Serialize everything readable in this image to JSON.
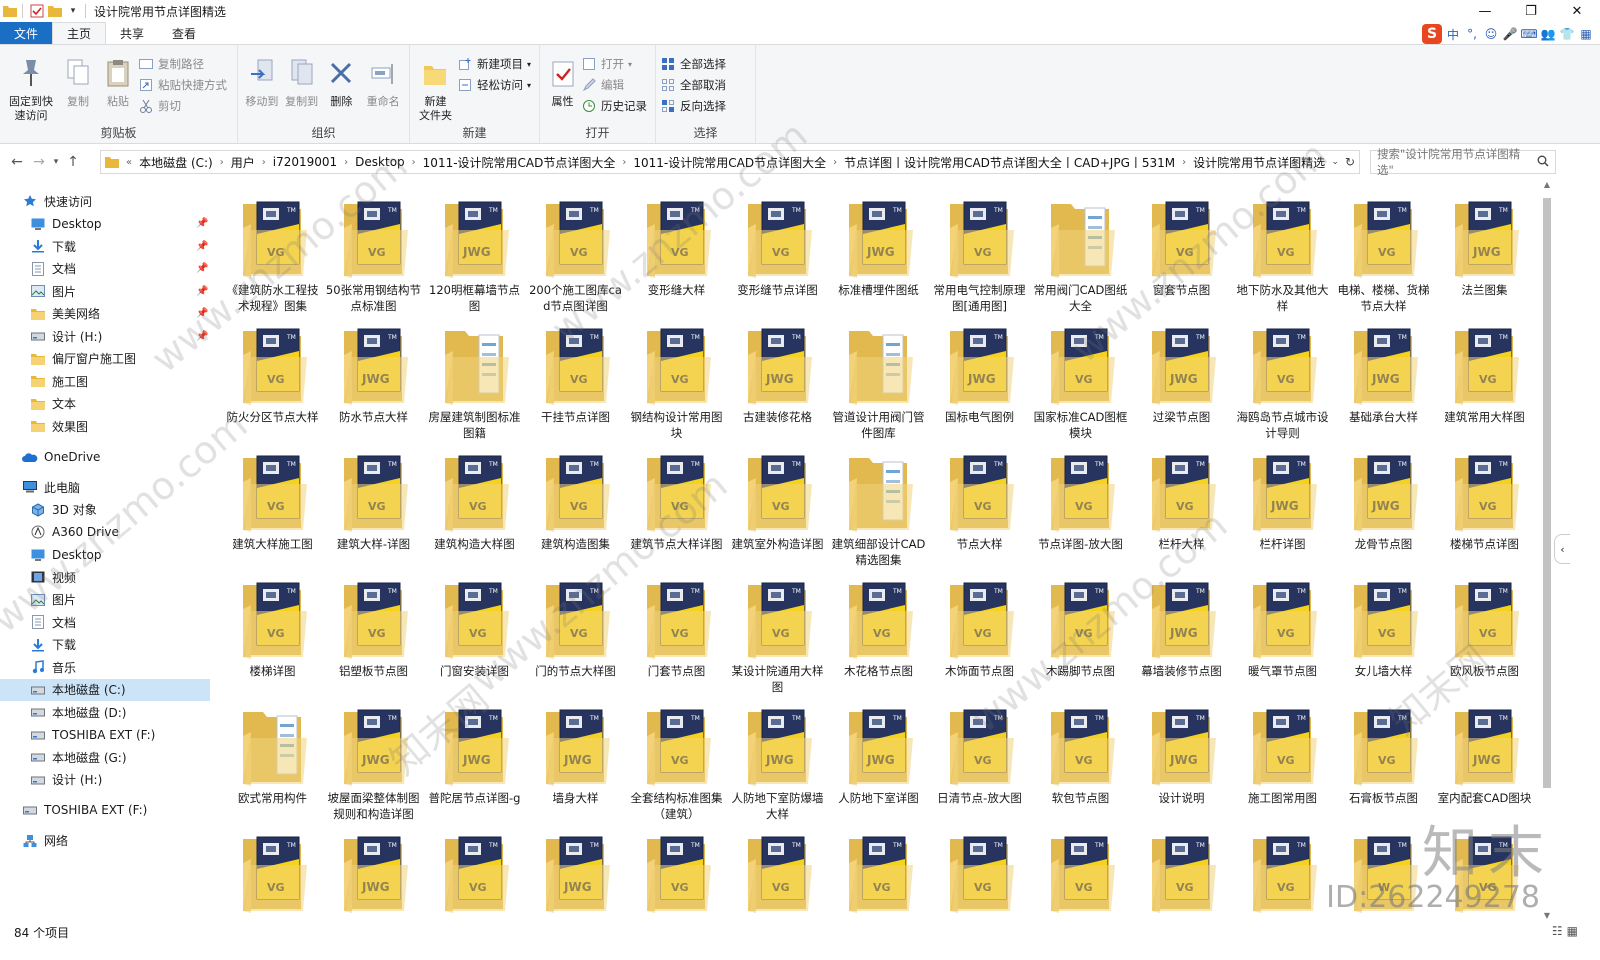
{
  "window": {
    "title": "设计院常用节点详图精选",
    "controls": [
      "—",
      "❐",
      "✕"
    ]
  },
  "ribbon_tabs": [
    {
      "label": "文件",
      "style": "file"
    },
    {
      "label": "主页",
      "style": "active"
    },
    {
      "label": "共享",
      "style": ""
    },
    {
      "label": "查看",
      "style": ""
    }
  ],
  "ime_bar": {
    "logo": "S",
    "items": [
      "中",
      "°,",
      "☺",
      "🎤",
      "⌨",
      "👥",
      "👕",
      "▦"
    ]
  },
  "ribbon": {
    "clipboard": {
      "label": "剪贴板",
      "pin": "固定到快\n速访问",
      "copy": "复制",
      "paste": "粘贴",
      "copy_path": "复制路径",
      "paste_shortcut": "粘贴快捷方式",
      "cut": "剪切"
    },
    "organize": {
      "label": "组织",
      "move_to": "移动到",
      "copy_to": "复制到",
      "delete": "删除",
      "rename": "重命名"
    },
    "new": {
      "label": "新建",
      "new_folder": "新建\n文件夹",
      "new_item": "新建项目",
      "easy_access": "轻松访问"
    },
    "open": {
      "label": "打开",
      "properties": "属性",
      "open": "打开",
      "edit": "编辑",
      "history": "历史记录"
    },
    "select": {
      "label": "选择",
      "select_all": "全部选择",
      "select_none": "全部取消",
      "invert": "反向选择"
    }
  },
  "address": {
    "breadcrumbs": [
      "本地磁盘 (C:)",
      "用户",
      "i72019001",
      "Desktop",
      "1011-设计院常用CAD节点详图大全",
      "1011-设计院常用CAD节点详图大全",
      "节点详图丨设计院常用CAD节点详图大全丨CAD+JPG丨531M",
      "设计院常用节点详图精选"
    ],
    "search_placeholder": "搜索\"设计院常用节点详图精选\""
  },
  "sidebar": [
    {
      "label": "快速访问",
      "icon": "star-icon",
      "indent": 22,
      "pin": false,
      "selected": false,
      "gap_before": false
    },
    {
      "label": "Desktop",
      "icon": "desktop-icon",
      "indent": 30,
      "pin": true,
      "selected": false,
      "gap_before": false
    },
    {
      "label": "下载",
      "icon": "download-icon",
      "indent": 30,
      "pin": true,
      "selected": false,
      "gap_before": false
    },
    {
      "label": "文档",
      "icon": "document-icon",
      "indent": 30,
      "pin": true,
      "selected": false,
      "gap_before": false
    },
    {
      "label": "图片",
      "icon": "picture-icon",
      "indent": 30,
      "pin": true,
      "selected": false,
      "gap_before": false
    },
    {
      "label": "美美网络",
      "icon": "folder-icon",
      "indent": 30,
      "pin": true,
      "selected": false,
      "gap_before": false
    },
    {
      "label": "设计 (H:)",
      "icon": "drive-icon",
      "indent": 30,
      "pin": true,
      "selected": false,
      "gap_before": false
    },
    {
      "label": "偏厅窗户施工图",
      "icon": "folder-icon",
      "indent": 30,
      "pin": false,
      "selected": false,
      "gap_before": false
    },
    {
      "label": "施工图",
      "icon": "folder-icon",
      "indent": 30,
      "pin": false,
      "selected": false,
      "gap_before": false
    },
    {
      "label": "文本",
      "icon": "folder-icon",
      "indent": 30,
      "pin": false,
      "selected": false,
      "gap_before": false
    },
    {
      "label": "效果图",
      "icon": "folder-icon",
      "indent": 30,
      "pin": false,
      "selected": false,
      "gap_before": false
    },
    {
      "label": "OneDrive",
      "icon": "cloud-icon",
      "indent": 22,
      "pin": false,
      "selected": false,
      "gap_before": true
    },
    {
      "label": "此电脑",
      "icon": "computer-icon",
      "indent": 22,
      "pin": false,
      "selected": false,
      "gap_before": true
    },
    {
      "label": "3D 对象",
      "icon": "cube-icon",
      "indent": 30,
      "pin": false,
      "selected": false,
      "gap_before": false
    },
    {
      "label": "A360 Drive",
      "icon": "a360-icon",
      "indent": 30,
      "pin": false,
      "selected": false,
      "gap_before": false
    },
    {
      "label": "Desktop",
      "icon": "desktop-icon",
      "indent": 30,
      "pin": false,
      "selected": false,
      "gap_before": false
    },
    {
      "label": "视频",
      "icon": "video-icon",
      "indent": 30,
      "pin": false,
      "selected": false,
      "gap_before": false
    },
    {
      "label": "图片",
      "icon": "picture-icon",
      "indent": 30,
      "pin": false,
      "selected": false,
      "gap_before": false
    },
    {
      "label": "文档",
      "icon": "document-icon",
      "indent": 30,
      "pin": false,
      "selected": false,
      "gap_before": false
    },
    {
      "label": "下载",
      "icon": "download-icon",
      "indent": 30,
      "pin": false,
      "selected": false,
      "gap_before": false
    },
    {
      "label": "音乐",
      "icon": "music-icon",
      "indent": 30,
      "pin": false,
      "selected": false,
      "gap_before": false
    },
    {
      "label": "本地磁盘 (C:)",
      "icon": "drive-icon",
      "indent": 30,
      "pin": false,
      "selected": true,
      "gap_before": false
    },
    {
      "label": "本地磁盘 (D:)",
      "icon": "drive-icon",
      "indent": 30,
      "pin": false,
      "selected": false,
      "gap_before": false
    },
    {
      "label": "TOSHIBA EXT (F:)",
      "icon": "drive-icon",
      "indent": 30,
      "pin": false,
      "selected": false,
      "gap_before": false
    },
    {
      "label": "本地磁盘 (G:)",
      "icon": "drive-icon",
      "indent": 30,
      "pin": false,
      "selected": false,
      "gap_before": false
    },
    {
      "label": "设计 (H:)",
      "icon": "drive-icon",
      "indent": 30,
      "pin": false,
      "selected": false,
      "gap_before": false
    },
    {
      "label": "TOSHIBA EXT (F:)",
      "icon": "drive-icon",
      "indent": 22,
      "pin": false,
      "selected": false,
      "gap_before": true
    },
    {
      "label": "网络",
      "icon": "network-icon",
      "indent": 22,
      "pin": false,
      "selected": false,
      "gap_before": true
    }
  ],
  "folders": [
    {
      "name": "《建筑防水工程技术规程》图集",
      "badge": "VG"
    },
    {
      "name": "50张常用钢结构节点标准图",
      "badge": "VG"
    },
    {
      "name": "120明框幕墙节点图",
      "badge": "JWG"
    },
    {
      "name": "200个施工图库cad节点图详图",
      "badge": "VG"
    },
    {
      "name": "变形缝大样",
      "badge": "VG"
    },
    {
      "name": "变形缝节点详图",
      "badge": "VG"
    },
    {
      "name": "标准槽埋件图纸",
      "badge": "JWG"
    },
    {
      "name": "常用电气控制原理图[通用图]",
      "badge": "VG"
    },
    {
      "name": "常用阀门CAD图纸大全",
      "badge": "PLAIN"
    },
    {
      "name": "窗套节点图",
      "badge": "VG"
    },
    {
      "name": "地下防水及其他大样",
      "badge": "VG"
    },
    {
      "name": "电梯、楼梯、货梯节点大样",
      "badge": "VG"
    },
    {
      "name": "法兰图集",
      "badge": "JWG"
    },
    {
      "name": "防火分区节点大样",
      "badge": "VG"
    },
    {
      "name": "防水节点大样",
      "badge": "JWG"
    },
    {
      "name": "房屋建筑制图标准图籍",
      "badge": "PLAIN"
    },
    {
      "name": "干挂节点详图",
      "badge": "VG"
    },
    {
      "name": "钢结构设计常用图块",
      "badge": "VG"
    },
    {
      "name": "古建装修花格",
      "badge": "JWG"
    },
    {
      "name": "管道设计用阀门管件图库",
      "badge": "PLAIN"
    },
    {
      "name": "国标电气图例",
      "badge": "JWG"
    },
    {
      "name": "国家标准CAD图框模块",
      "badge": "VG"
    },
    {
      "name": "过梁节点图",
      "badge": "JWG"
    },
    {
      "name": "海鸥岛节点城市设计导则",
      "badge": "VG"
    },
    {
      "name": "基础承台大样",
      "badge": "JWG"
    },
    {
      "name": "建筑常用大样图",
      "badge": "VG"
    },
    {
      "name": "建筑大样施工图",
      "badge": "VG"
    },
    {
      "name": "建筑大样-详图",
      "badge": "VG"
    },
    {
      "name": "建筑构造大样图",
      "badge": "VG"
    },
    {
      "name": "建筑构造图集",
      "badge": "VG"
    },
    {
      "name": "建筑节点大样详图",
      "badge": "VG"
    },
    {
      "name": "建筑室外构造详图",
      "badge": "VG"
    },
    {
      "name": "建筑细部设计CAD精选图集",
      "badge": "PLAIN"
    },
    {
      "name": "节点大样",
      "badge": "VG"
    },
    {
      "name": "节点详图-放大图",
      "badge": "VG"
    },
    {
      "name": "栏杆大样",
      "badge": "VG"
    },
    {
      "name": "栏杆详图",
      "badge": "JWG"
    },
    {
      "name": "龙骨节点图",
      "badge": "JWG"
    },
    {
      "name": "楼梯节点详图",
      "badge": "VG"
    },
    {
      "name": "楼梯详图",
      "badge": "VG"
    },
    {
      "name": "铝塑板节点图",
      "badge": "VG"
    },
    {
      "name": "门窗安装详图",
      "badge": "VG"
    },
    {
      "name": "门的节点大样图",
      "badge": "VG"
    },
    {
      "name": "门套节点图",
      "badge": "VG"
    },
    {
      "name": "某设计院通用大样图",
      "badge": "VG"
    },
    {
      "name": "木花格节点图",
      "badge": "VG"
    },
    {
      "name": "木饰面节点图",
      "badge": "VG"
    },
    {
      "name": "木踢脚节点图",
      "badge": "VG"
    },
    {
      "name": "幕墙装修节点图",
      "badge": "JWG"
    },
    {
      "name": "暖气罩节点图",
      "badge": "VG"
    },
    {
      "name": "女儿墙大样",
      "badge": "VG"
    },
    {
      "name": "欧风板节点图",
      "badge": "VG"
    },
    {
      "name": "欧式常用构件",
      "badge": "PLAIN"
    },
    {
      "name": "坡屋面梁整体制图规则和构造详图",
      "badge": "JWG"
    },
    {
      "name": "普陀居节点详图-g",
      "badge": "JWG"
    },
    {
      "name": "墙身大样",
      "badge": "JWG"
    },
    {
      "name": "全套结构标准图集（建筑）",
      "badge": "VG"
    },
    {
      "name": "人防地下室防爆墙大样",
      "badge": "JWG"
    },
    {
      "name": "人防地下室详图",
      "badge": "JWG"
    },
    {
      "name": "日清节点-放大图",
      "badge": "VG"
    },
    {
      "name": "软包节点图",
      "badge": "VG"
    },
    {
      "name": "设计说明",
      "badge": "JWG"
    },
    {
      "name": "施工图常用图",
      "badge": "VG"
    },
    {
      "name": "石膏板节点图",
      "badge": "VG"
    },
    {
      "name": "室内配套CAD图块",
      "badge": "JWG"
    },
    {
      "name": "",
      "badge": "VG"
    },
    {
      "name": "",
      "badge": "JWG"
    },
    {
      "name": "",
      "badge": "VG"
    },
    {
      "name": "",
      "badge": "JWG"
    },
    {
      "name": "",
      "badge": "VG"
    },
    {
      "name": "",
      "badge": "VG"
    },
    {
      "name": "",
      "badge": "VG"
    },
    {
      "name": "",
      "badge": "VG"
    },
    {
      "name": "",
      "badge": "VG"
    },
    {
      "name": "",
      "badge": "VG"
    },
    {
      "name": "",
      "badge": "VG"
    },
    {
      "name": "",
      "badge": "W"
    },
    {
      "name": "",
      "badge": "VG"
    }
  ],
  "status": {
    "item_count": "84 个项目"
  },
  "watermark": {
    "brand": "知末",
    "id": "ID:262249278",
    "url": "www.znzmo.com",
    "cn": "知末网"
  },
  "colors": {
    "folder": "#f3d37a",
    "folder_dark": "#e1b94f",
    "doc_navy": "#27345f",
    "badge_yellow": "#f4d21e",
    "accent": "#1a6fc4",
    "selection": "#cce4f7"
  }
}
